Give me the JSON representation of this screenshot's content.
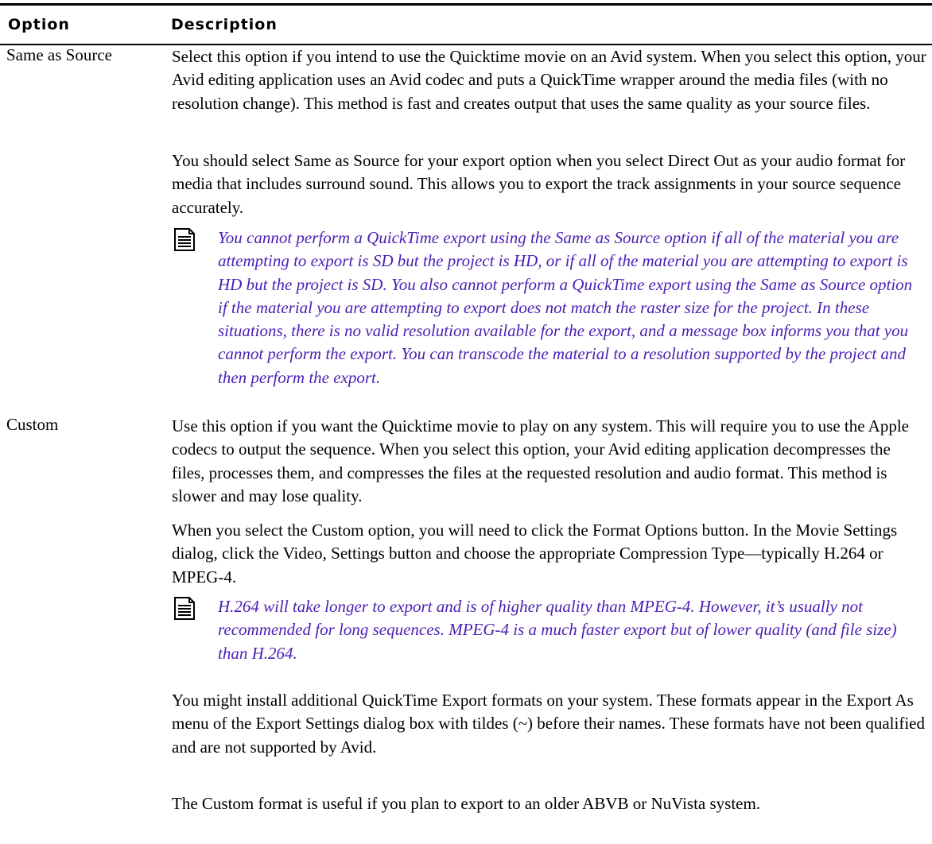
{
  "table": {
    "header": {
      "option": "Option",
      "description": "Description"
    },
    "rows": [
      {
        "option": "Same as Source",
        "p1": "Select this option if you intend to use the Quicktime movie on an Avid system. When you select this option, your Avid editing application uses an Avid codec and puts a QuickTime wrapper around the media files (with no resolution change). This method is fast and creates output that uses the same quality as your source files.",
        "p2": "You should select Same as Source for your export option when you select Direct Out as your audio format for media that includes surround sound. This allows you to export the track assignments in your source sequence accurately.",
        "note": "You cannot perform a QuickTime export using the Same as Source option if all of the material you are attempting to export is SD but the project is HD, or if all of the material you are attempting to export is HD but the project is SD. You also cannot perform a QuickTime export using the Same as Source option if the material you are attempting to export does not match the raster size for the project. In these situations, there is no valid resolution available for the export, and a message box informs you that you cannot perform the export. You can transcode the material to a resolution supported by the project and then perform the export."
      },
      {
        "option": "Custom",
        "p1": "Use this option if you want the Quicktime movie to play on any system. This will require you to use the Apple codecs to output the sequence. When you select this option, your Avid editing application decompresses the files, processes them, and compresses the files at the requested resolution and audio format. This method is slower and may lose quality.",
        "p2": "When you select the Custom option, you will need to click the Format Options button. In the Movie Settings dialog, click the Video, Settings button and choose the appropriate Compression Type—typically H.264 or MPEG-4.",
        "note": "H.264 will take longer to export and is of higher quality than MPEG-4. However, it’s usually not recommended for long sequences. MPEG-4 is a much faster export but of lower quality (and file size) than H.264.",
        "p3": "You might install additional QuickTime Export formats on your system. These formats appear in the Export As menu of the Export Settings dialog box with tildes (~) before their names. These formats have not been qualified and are not supported by Avid.",
        "p4": "The Custom format is useful if you plan to export to an older ABVB or NuVista system."
      }
    ]
  },
  "icons": {
    "note": "note-icon"
  }
}
